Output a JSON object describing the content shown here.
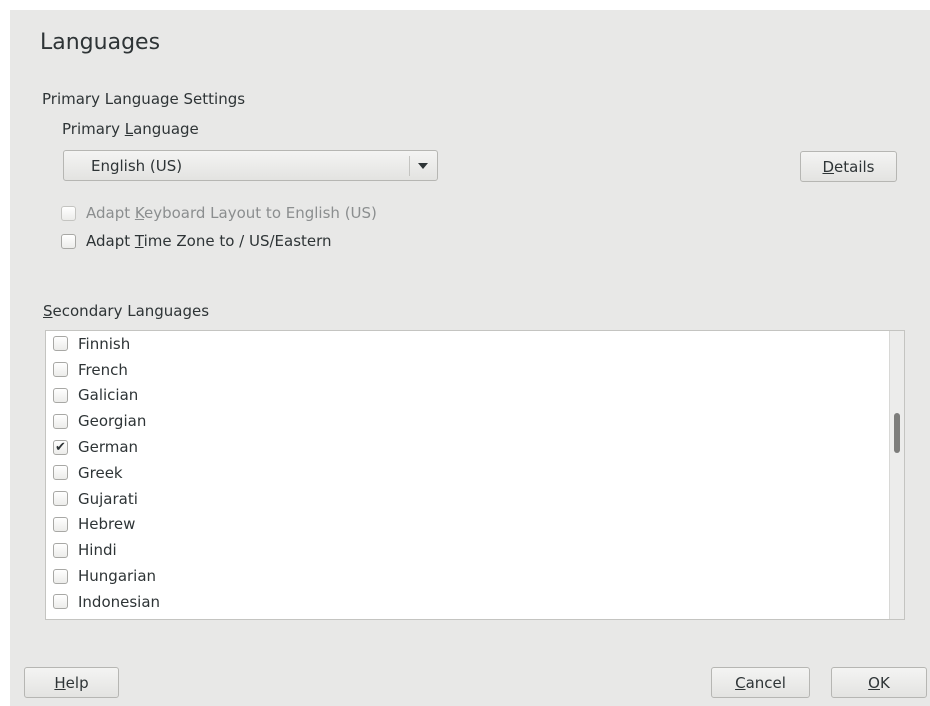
{
  "page": {
    "title": "Languages"
  },
  "primary": {
    "section_title": "Primary Language Settings",
    "label_pre": "Primary ",
    "label_mnemonic": "L",
    "label_post": "anguage",
    "selected": "English (US)",
    "details_pre": "",
    "details_mnemonic": "D",
    "details_post": "etails"
  },
  "options": {
    "keyboard": {
      "pre": "Adapt ",
      "mnemonic": "K",
      "post": "eyboard Layout to English (US)",
      "checked": false,
      "enabled": false
    },
    "timezone": {
      "pre": "Adapt ",
      "mnemonic": "T",
      "post": "ime Zone to  / US/Eastern",
      "checked": false,
      "enabled": true
    }
  },
  "secondary": {
    "label_mnemonic": "S",
    "label_post": "econdary Languages",
    "items": [
      {
        "label": "Finnish",
        "checked": false
      },
      {
        "label": "French",
        "checked": false
      },
      {
        "label": "Galician",
        "checked": false
      },
      {
        "label": "Georgian",
        "checked": false
      },
      {
        "label": "German",
        "checked": true
      },
      {
        "label": "Greek",
        "checked": false
      },
      {
        "label": "Gujarati",
        "checked": false
      },
      {
        "label": "Hebrew",
        "checked": false
      },
      {
        "label": "Hindi",
        "checked": false
      },
      {
        "label": "Hungarian",
        "checked": false
      },
      {
        "label": "Indonesian",
        "checked": false
      }
    ]
  },
  "footer": {
    "help_mnemonic": "H",
    "help_post": "elp",
    "cancel_mnemonic": "C",
    "cancel_post": "ancel",
    "ok_mnemonic": "O",
    "ok_post": "K"
  },
  "icons": {
    "combo_arrow": "chevron-down-icon",
    "check": "check-icon"
  },
  "colors": {
    "window_bg": "#e8e8e7",
    "text": "#2e3436",
    "disabled_text": "#8b8e8f"
  }
}
